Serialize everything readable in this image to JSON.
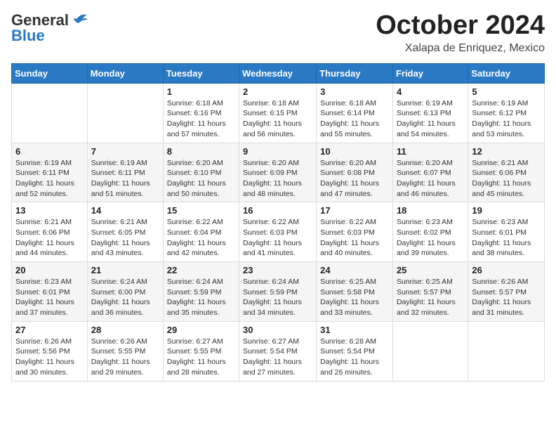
{
  "header": {
    "logo_general": "General",
    "logo_blue": "Blue",
    "month_title": "October 2024",
    "location": "Xalapa de Enriquez, Mexico"
  },
  "days_of_week": [
    "Sunday",
    "Monday",
    "Tuesday",
    "Wednesday",
    "Thursday",
    "Friday",
    "Saturday"
  ],
  "weeks": [
    [
      {
        "day": "",
        "info": ""
      },
      {
        "day": "",
        "info": ""
      },
      {
        "day": "1",
        "sunrise": "6:18 AM",
        "sunset": "6:16 PM",
        "daylight": "11 hours and 57 minutes."
      },
      {
        "day": "2",
        "sunrise": "6:18 AM",
        "sunset": "6:15 PM",
        "daylight": "11 hours and 56 minutes."
      },
      {
        "day": "3",
        "sunrise": "6:18 AM",
        "sunset": "6:14 PM",
        "daylight": "11 hours and 55 minutes."
      },
      {
        "day": "4",
        "sunrise": "6:19 AM",
        "sunset": "6:13 PM",
        "daylight": "11 hours and 54 minutes."
      },
      {
        "day": "5",
        "sunrise": "6:19 AM",
        "sunset": "6:12 PM",
        "daylight": "11 hours and 53 minutes."
      }
    ],
    [
      {
        "day": "6",
        "sunrise": "6:19 AM",
        "sunset": "6:11 PM",
        "daylight": "11 hours and 52 minutes."
      },
      {
        "day": "7",
        "sunrise": "6:19 AM",
        "sunset": "6:11 PM",
        "daylight": "11 hours and 51 minutes."
      },
      {
        "day": "8",
        "sunrise": "6:20 AM",
        "sunset": "6:10 PM",
        "daylight": "11 hours and 50 minutes."
      },
      {
        "day": "9",
        "sunrise": "6:20 AM",
        "sunset": "6:09 PM",
        "daylight": "11 hours and 48 minutes."
      },
      {
        "day": "10",
        "sunrise": "6:20 AM",
        "sunset": "6:08 PM",
        "daylight": "11 hours and 47 minutes."
      },
      {
        "day": "11",
        "sunrise": "6:20 AM",
        "sunset": "6:07 PM",
        "daylight": "11 hours and 46 minutes."
      },
      {
        "day": "12",
        "sunrise": "6:21 AM",
        "sunset": "6:06 PM",
        "daylight": "11 hours and 45 minutes."
      }
    ],
    [
      {
        "day": "13",
        "sunrise": "6:21 AM",
        "sunset": "6:06 PM",
        "daylight": "11 hours and 44 minutes."
      },
      {
        "day": "14",
        "sunrise": "6:21 AM",
        "sunset": "6:05 PM",
        "daylight": "11 hours and 43 minutes."
      },
      {
        "day": "15",
        "sunrise": "6:22 AM",
        "sunset": "6:04 PM",
        "daylight": "11 hours and 42 minutes."
      },
      {
        "day": "16",
        "sunrise": "6:22 AM",
        "sunset": "6:03 PM",
        "daylight": "11 hours and 41 minutes."
      },
      {
        "day": "17",
        "sunrise": "6:22 AM",
        "sunset": "6:03 PM",
        "daylight": "11 hours and 40 minutes."
      },
      {
        "day": "18",
        "sunrise": "6:23 AM",
        "sunset": "6:02 PM",
        "daylight": "11 hours and 39 minutes."
      },
      {
        "day": "19",
        "sunrise": "6:23 AM",
        "sunset": "6:01 PM",
        "daylight": "11 hours and 38 minutes."
      }
    ],
    [
      {
        "day": "20",
        "sunrise": "6:23 AM",
        "sunset": "6:01 PM",
        "daylight": "11 hours and 37 minutes."
      },
      {
        "day": "21",
        "sunrise": "6:24 AM",
        "sunset": "6:00 PM",
        "daylight": "11 hours and 36 minutes."
      },
      {
        "day": "22",
        "sunrise": "6:24 AM",
        "sunset": "5:59 PM",
        "daylight": "11 hours and 35 minutes."
      },
      {
        "day": "23",
        "sunrise": "6:24 AM",
        "sunset": "5:59 PM",
        "daylight": "11 hours and 34 minutes."
      },
      {
        "day": "24",
        "sunrise": "6:25 AM",
        "sunset": "5:58 PM",
        "daylight": "11 hours and 33 minutes."
      },
      {
        "day": "25",
        "sunrise": "6:25 AM",
        "sunset": "5:57 PM",
        "daylight": "11 hours and 32 minutes."
      },
      {
        "day": "26",
        "sunrise": "6:26 AM",
        "sunset": "5:57 PM",
        "daylight": "11 hours and 31 minutes."
      }
    ],
    [
      {
        "day": "27",
        "sunrise": "6:26 AM",
        "sunset": "5:56 PM",
        "daylight": "11 hours and 30 minutes."
      },
      {
        "day": "28",
        "sunrise": "6:26 AM",
        "sunset": "5:55 PM",
        "daylight": "11 hours and 29 minutes."
      },
      {
        "day": "29",
        "sunrise": "6:27 AM",
        "sunset": "5:55 PM",
        "daylight": "11 hours and 28 minutes."
      },
      {
        "day": "30",
        "sunrise": "6:27 AM",
        "sunset": "5:54 PM",
        "daylight": "11 hours and 27 minutes."
      },
      {
        "day": "31",
        "sunrise": "6:28 AM",
        "sunset": "5:54 PM",
        "daylight": "11 hours and 26 minutes."
      },
      {
        "day": "",
        "info": ""
      },
      {
        "day": "",
        "info": ""
      }
    ]
  ],
  "labels": {
    "sunrise_prefix": "Sunrise: ",
    "sunset_prefix": "Sunset: ",
    "daylight_prefix": "Daylight: "
  }
}
